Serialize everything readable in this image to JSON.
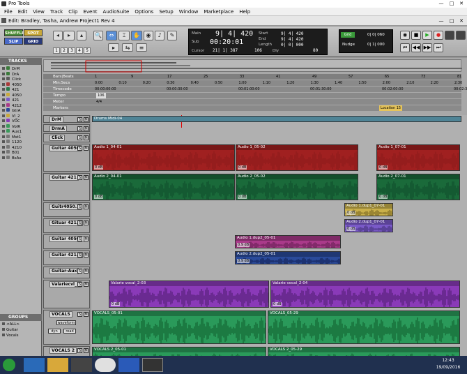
{
  "window": {
    "app_title": "Pro Tools",
    "doc_title": "Edit: Bradley, Tasha, Andrew Project1 Rev 4"
  },
  "menu": [
    "File",
    "Edit",
    "View",
    "Track",
    "Clip",
    "Event",
    "AudioSuite",
    "Options",
    "Setup",
    "Window",
    "Marketplace",
    "Help"
  ],
  "toolbar": {
    "modes": [
      "SHUFFLE",
      "SPOT",
      "SLIP",
      "GRID"
    ],
    "zoom_presets": [
      "1",
      "2",
      "3",
      "4",
      "5"
    ],
    "counter": {
      "main_label": "Main",
      "main_value": "9| 4| 420",
      "sub_label": "Sub",
      "sub_value": "00:20:01",
      "cursor_label": "Cursor",
      "cursor_value": "21| 1| 387",
      "start_label": "Start",
      "start_value": "9| 4| 420",
      "end_label": "End",
      "end_value": "9| 4| 420",
      "length_label": "Length",
      "length_value": "0| 0| 000",
      "db_value": "106",
      "dly_label": "Dly",
      "extra_value": "80"
    },
    "grid": {
      "grid_label": "Grid",
      "grid_value": "0| 0| 060",
      "nudge_label": "Nudge",
      "nudge_value": "0| 1| 000"
    }
  },
  "tracks_panel": {
    "title": "TRACKS",
    "items": [
      "DrM",
      "DrA",
      "Click",
      "4050",
      "421",
      "4050",
      "421",
      "4212",
      "GtrA",
      "Vl_2",
      "VOC",
      "VolR",
      "Aux1",
      "Mst1",
      "1120",
      "4210",
      "B01",
      "BsAx"
    ]
  },
  "groups_panel": {
    "title": "GROUPS",
    "items": [
      "<ALL>",
      "Guitar",
      "Vocals"
    ]
  },
  "rulers": {
    "bars_label": "Bars|Beats",
    "min_label": "Min:Secs",
    "tc_label": "Timecode",
    "tempo_label": "Tempo",
    "tempo_value": "106",
    "meter_label": "Meter",
    "meter_value": "4/4",
    "markers_label": "Markers",
    "marker_name": "Location 15",
    "bars": [
      "1",
      "9",
      "17",
      "25",
      "33",
      "41",
      "49",
      "57",
      "65",
      "73",
      "81"
    ],
    "mins": [
      "0:00",
      "0:10",
      "0:20",
      "0:30",
      "0:40",
      "0:50",
      "1:00",
      "1:10",
      "1:20",
      "1:30",
      "1:40",
      "1:50",
      "2:00",
      "2:10",
      "2:20",
      "2:30"
    ],
    "tcs": [
      "00:00:00:00",
      "00:00:30:00",
      "00:01:00:00",
      "00:01:30:00",
      "00:02:00:00",
      "00:02:30:00"
    ]
  },
  "tracks": [
    {
      "name": "DrM",
      "clips": [
        {
          "label": "Drums Midi-04"
        }
      ]
    },
    {
      "name": "DrmA",
      "clips": []
    },
    {
      "name": "Click",
      "clips": []
    },
    {
      "name": "Guitar 4050",
      "clips": [
        {
          "label": "Audio 1_04-01",
          "vol": "0 dB"
        },
        {
          "label": "Audio 1_05-02",
          "vol": "0 dB"
        },
        {
          "label": "Audio 1_07-01",
          "vol": "0 dB"
        }
      ]
    },
    {
      "name": "Guitar 421",
      "clips": [
        {
          "label": "Audio 2_04-01",
          "vol": "0 dB"
        },
        {
          "label": "Audio 2_05-02",
          "vol": "0 dB"
        },
        {
          "label": "Audio 2_07-01",
          "vol": "0 dB"
        }
      ]
    },
    {
      "name": "Guitr4050.1",
      "clips": [
        {
          "label": "Audio 1.dup1_07-01",
          "vol": "0 dB"
        }
      ]
    },
    {
      "name": "Gituar 421.1",
      "clips": [
        {
          "label": "Audio 2.dup1_07-01",
          "vol": "0 dB"
        }
      ]
    },
    {
      "name": "Guitar 40502",
      "clips": [
        {
          "label": "Audio 1.dup2_05-01",
          "vol": "0.9 dB"
        }
      ]
    },
    {
      "name": "Guitar 421.2",
      "clips": [
        {
          "label": "Audio 2.dup2_05-01",
          "vol": "0.9 dB"
        }
      ]
    },
    {
      "name": "Guitar-Aux",
      "clips": []
    },
    {
      "name": "Valariecvl_2",
      "clips": [
        {
          "label": "Valarie vocal_2-03",
          "vol": "0 dB"
        },
        {
          "label": "Valarie vocal_2-04",
          "vol": "0 dB"
        }
      ]
    },
    {
      "name": "VOCALS",
      "clips": [
        {
          "label": "VOCALS_05-01"
        },
        {
          "label": "VOCALS_05-29"
        }
      ],
      "view": "waveform",
      "extra": [
        "dyn",
        "read"
      ]
    },
    {
      "name": "VOCALS 2",
      "clips": [
        {
          "label": "VOCALS 2_05-01"
        },
        {
          "label": "VOCALS 2_05-29"
        }
      ]
    }
  ],
  "taskbar": {
    "time": "12:43",
    "date": "19/09/2016"
  }
}
